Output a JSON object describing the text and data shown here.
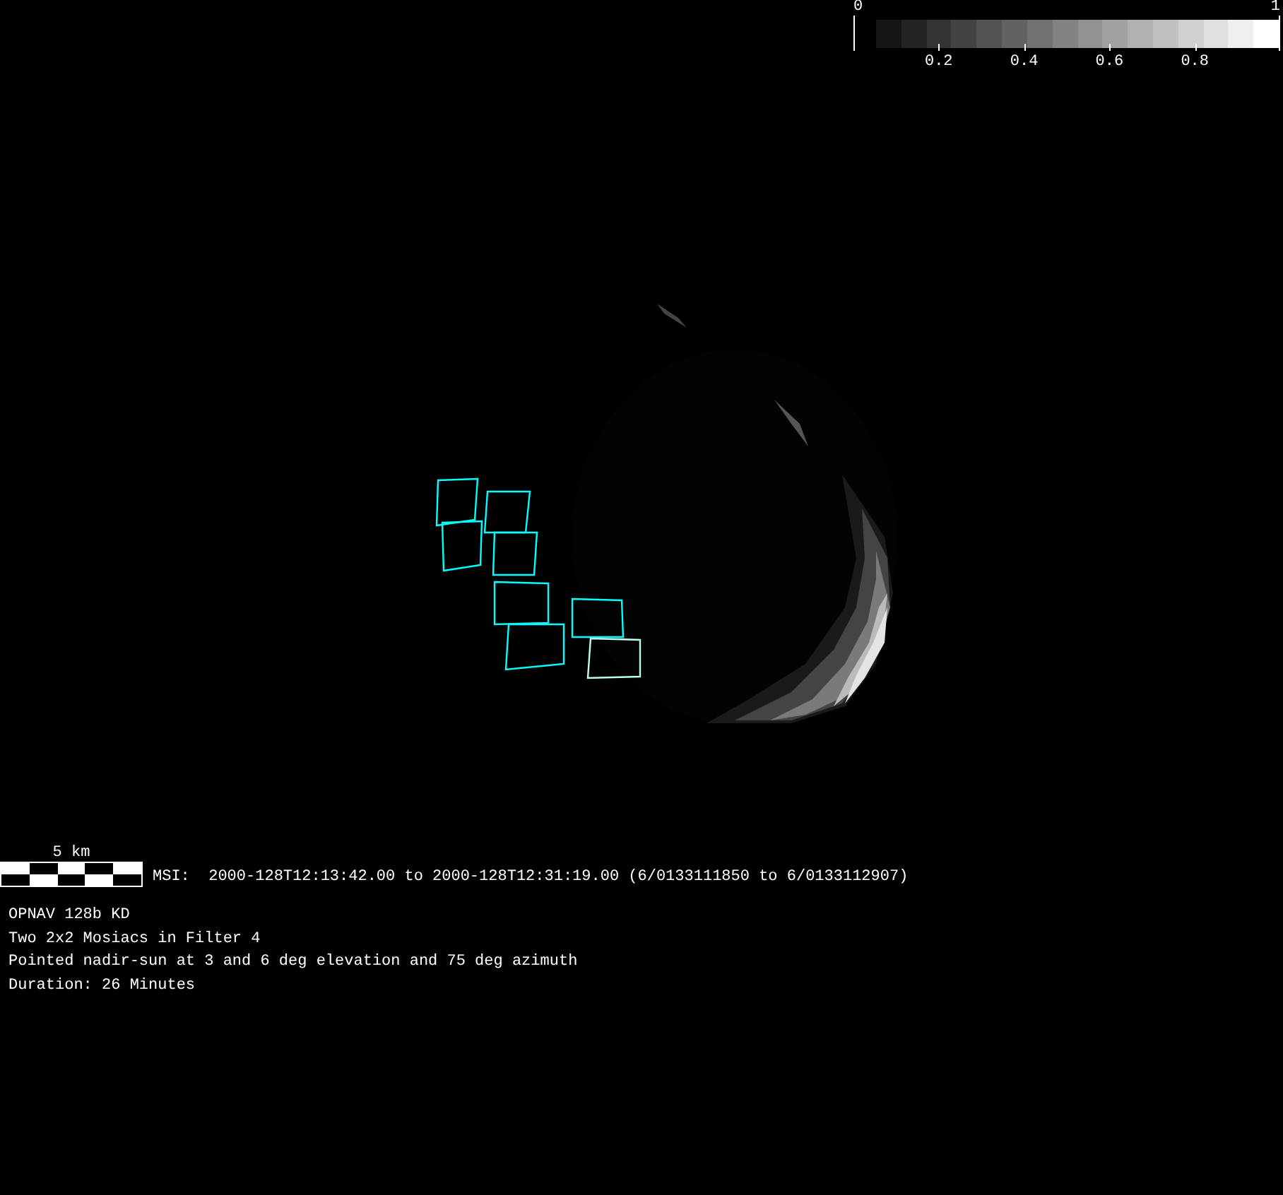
{
  "colorbar": {
    "min_label": "0",
    "max_label": "1",
    "ticks": [
      "0.2",
      "0.4",
      "0.6",
      "0.8"
    ]
  },
  "scale_bar": {
    "label": "5 km"
  },
  "msi_line": "MSI:  2000-128T12:13:42.00 to 2000-128T12:31:19.00 (6/0133111850 to 6/0133112907)",
  "notes": [
    "OPNAV 128b KD",
    "Two 2x2 Mosiacs in Filter 4",
    "Pointed nadir-sun at 3 and 6 deg elevation and 75 deg azimuth",
    "Duration: 26 Minutes"
  ]
}
